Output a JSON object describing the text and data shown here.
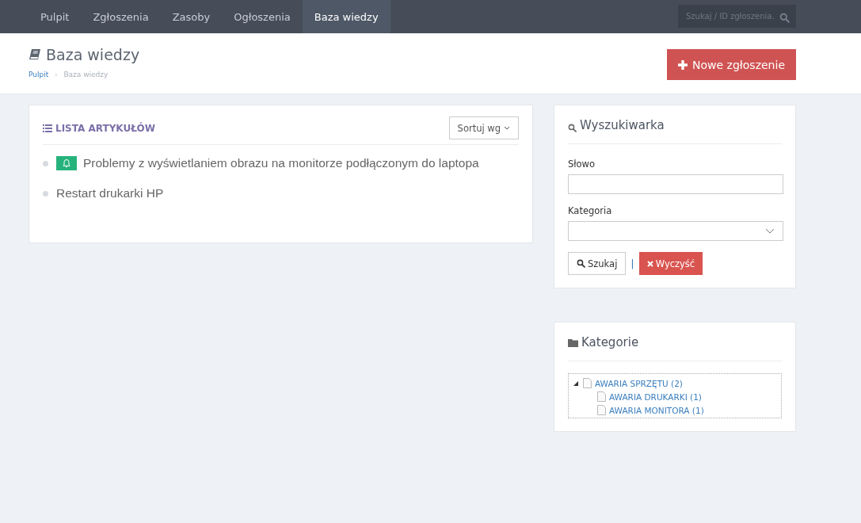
{
  "nav": {
    "items": [
      {
        "label": "Pulpit",
        "selected": false
      },
      {
        "label": "Zgłoszenia",
        "selected": false
      },
      {
        "label": "Zasoby",
        "selected": false
      },
      {
        "label": "Ogłoszenia",
        "selected": false
      },
      {
        "label": "Baza wiedzy",
        "selected": true
      }
    ],
    "search": {
      "placeholder": "Szukaj / ID zgłoszenia."
    }
  },
  "header": {
    "title": "Baza wiedzy",
    "breadcrumbs": [
      "Pulpit",
      "Baza wiedzy"
    ],
    "breadcrumb_separator": "›",
    "new_button": "Nowe zgłoszenie"
  },
  "articles": {
    "title": "LISTA ARTYKUŁÓW",
    "sort_button": "Sortuj wg",
    "items": [
      {
        "title": "Problemy z wyświetlaniem obrazu na monitorze podłączonym do laptopa",
        "flagged": true
      },
      {
        "title": "Restart drukarki HP",
        "flagged": false
      }
    ]
  },
  "search_panel": {
    "title": "Wyszukiwarka",
    "word_label": "Słowo",
    "category_label": "Kategoria",
    "search_button": "Szukaj",
    "separator": "|",
    "clear_button": "Wyczyść"
  },
  "categories": {
    "title": "Kategorie",
    "tree": [
      {
        "label": "AWARIA SPRZĘTU (2)",
        "expanded": true,
        "children": [
          {
            "label": "AWARIA DRUKARKI (1)"
          },
          {
            "label": "AWARIA MONITORA (1)"
          }
        ]
      }
    ]
  }
}
